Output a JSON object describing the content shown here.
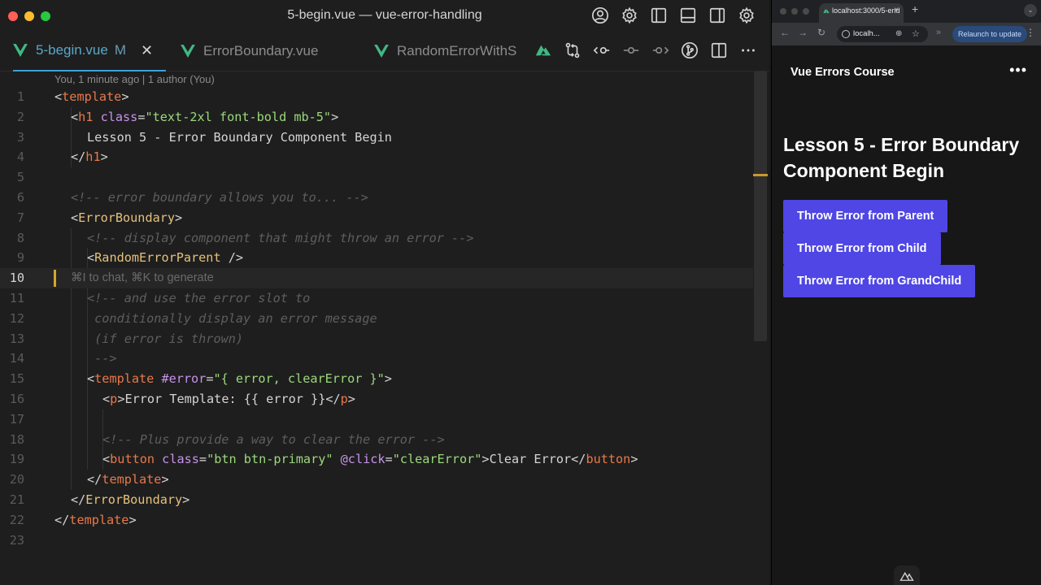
{
  "editor": {
    "window_title": "5-begin.vue — vue-error-handling",
    "title_icons": [
      "account-icon",
      "gear-icon",
      "sidebar-left-icon",
      "panel-bottom-icon",
      "sidebar-right-icon",
      "settings-icon"
    ],
    "tabs": [
      {
        "label": "5-begin.vue",
        "modified": "M",
        "close": "✕"
      },
      {
        "label": "ErrorBoundary.vue"
      },
      {
        "label": "RandomErrorWithS"
      }
    ],
    "tab_actions": [
      "nuxt-icon",
      "compare-icon",
      "git-prev-icon",
      "git-commit-icon",
      "git-next-icon",
      "git-graph-icon",
      "split-editor-icon",
      "more-icon"
    ],
    "blame": "You, 1 minute ago | 1 author (You)",
    "line_numbers": [
      "1",
      "2",
      "3",
      "4",
      "5",
      "6",
      "7",
      "8",
      "9",
      "10",
      "11",
      "12",
      "13",
      "14",
      "15",
      "16",
      "17",
      "18",
      "19",
      "20",
      "21",
      "22",
      "23"
    ],
    "code": {
      "l1_open": "<",
      "l1_tag": "template",
      "l1_close": ">",
      "l2_open": "<",
      "l2_tag": "h1",
      "l2_attr": " class",
      "l2_eq": "=",
      "l2_str": "\"text-2xl font-bold mb-5\"",
      "l2_close": ">",
      "l3_text": "Lesson 5 - Error Boundary Component Begin",
      "l4_open": "</",
      "l4_tag": "h1",
      "l4_close": ">",
      "l6_cmt": "<!-- error boundary allows you to... -->",
      "l7_open": "<",
      "l7_comp": "ErrorBoundary",
      "l7_close": ">",
      "l8_cmt": "<!-- display component that might throw an error -->",
      "l9_open": "<",
      "l9_comp": "RandomErrorParent",
      "l9_close": " />",
      "l10_hint": "⌘I to chat, ⌘K to generate",
      "l11_cmt": "<!-- and use the error slot to",
      "l12_cmt": " conditionally display an error message",
      "l13_cmt": " (if error is thrown)",
      "l14_cmt": " -->",
      "l15_open": "<",
      "l15_tag": "template",
      "l15_attr": " #error",
      "l15_eq": "=",
      "l15_str": "\"{ error, clearError }\"",
      "l15_close": ">",
      "l16_open": "<",
      "l16_tag": "p",
      "l16_mid": ">Error Template: {{ error }}</",
      "l16_tag2": "p",
      "l16_close": ">",
      "l18_cmt": "<!-- Plus provide a way to clear the error -->",
      "l19_open": "<",
      "l19_tag": "button",
      "l19_attr": " class",
      "l19_eq": "=",
      "l19_str": "\"btn btn-primary\"",
      "l19_attr2": " @click",
      "l19_eq2": "=",
      "l19_str2": "\"clearError\"",
      "l19_mid": ">Clear Error</",
      "l19_tag2": "button",
      "l19_close": ">",
      "l20_open": "</",
      "l20_tag": "template",
      "l20_close": ">",
      "l21_open": "</",
      "l21_comp": "ErrorBoundary",
      "l21_close": ">",
      "l22_open": "</",
      "l22_tag": "template",
      "l22_close": ">"
    },
    "colors": {
      "background": "#1e1e1e",
      "tag": "#e8794a",
      "component": "#e6c07b",
      "attribute": "#c792ea",
      "string": "#9cd87c",
      "comment": "#5e5e5e",
      "active_tab": "#5aa7c7",
      "caret": "#d7a629"
    }
  },
  "browser": {
    "tab_title": "localhost:3000/5-end",
    "tab_close": "×",
    "new_tab": "+",
    "address": "localh...",
    "relaunch": "Relaunch to update",
    "page": {
      "app_name": "Vue Errors Course",
      "menu": "•••",
      "title": "Lesson 5 - Error Boundary Component Begin",
      "buttons": [
        {
          "label": "Throw Error from Parent"
        },
        {
          "label": "Throw Error from Child"
        },
        {
          "label": "Throw Error from GrandChild"
        }
      ]
    },
    "colors": {
      "button": "#4f46e5",
      "page_bg": "#171717",
      "relaunch_bg": "#2a4a7a"
    }
  }
}
